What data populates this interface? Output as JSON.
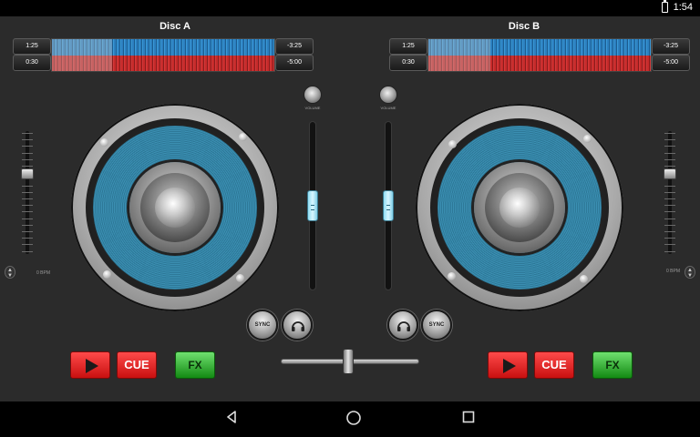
{
  "status": {
    "time": "1:54"
  },
  "deck_a": {
    "title": "Disc A",
    "elapsed": "1:25",
    "remaining": "-3:25",
    "cue_time": "0:30",
    "cue_remaining": "-5:00",
    "progress": 0.27,
    "bpm_label": "0 BPM",
    "volume_label": "VOLUME",
    "volume_level": 0.5,
    "pitch_level": 0.35,
    "sync_label": "SYNC",
    "cue_label": "CUE",
    "fx_label": "FX"
  },
  "deck_b": {
    "title": "Disc B",
    "elapsed": "1:25",
    "remaining": "-3:25",
    "cue_time": "0:30",
    "cue_remaining": "-5:00",
    "progress": 0.28,
    "bpm_label": "0 BPM",
    "volume_label": "VOLUME",
    "volume_level": 0.5,
    "pitch_level": 0.35,
    "sync_label": "SYNC",
    "cue_label": "CUE",
    "fx_label": "FX"
  },
  "crossfader": {
    "position": 0.49
  },
  "icons": {
    "battery": "battery-icon",
    "headphones": "headphones-icon",
    "play": "play-icon",
    "back": "back-icon",
    "home": "home-icon",
    "recents": "recents-icon"
  }
}
